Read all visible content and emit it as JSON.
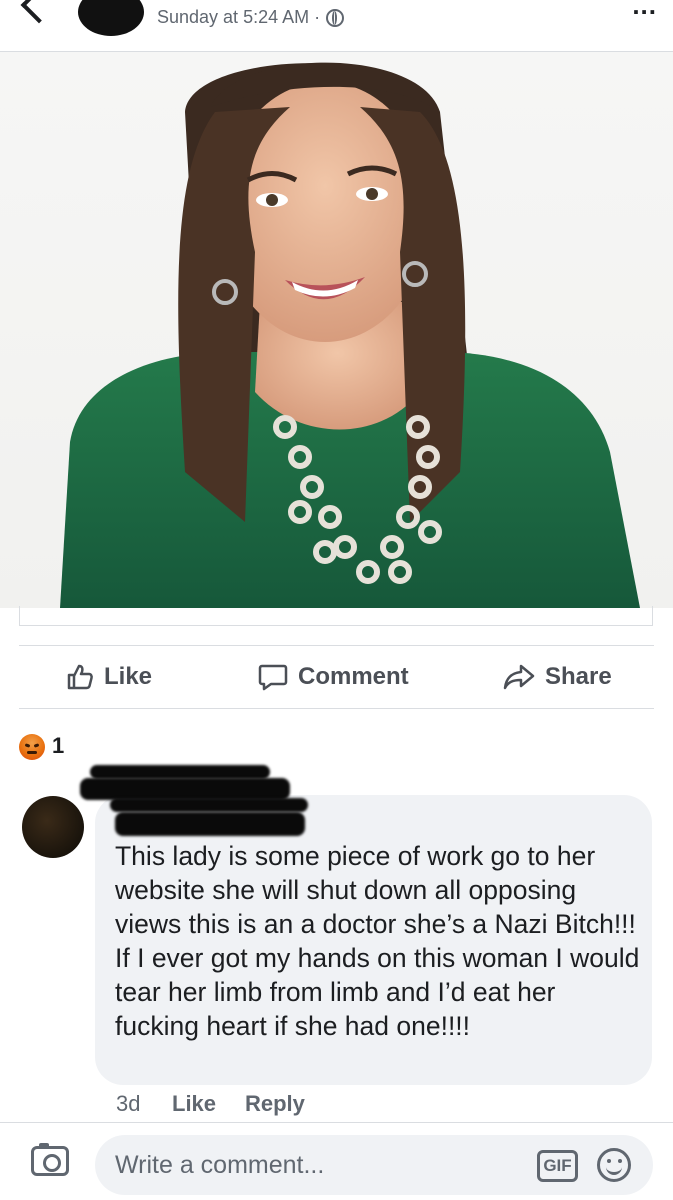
{
  "post": {
    "timestamp": "Sunday at 5:24 AM ·",
    "more_label": "..."
  },
  "actions": {
    "like": "Like",
    "comment": "Comment",
    "share": "Share"
  },
  "reactions": {
    "count": "1"
  },
  "comment": {
    "text": "This lady is some piece of work go to her website she will shut down all opposing views this is an a doctor she’s a Nazi Bitch!!! If I ever got my hands on this woman I would tear her limb from limb and I’d eat her fucking heart if she had one!!!!",
    "age": "3d",
    "like_label": "Like",
    "reply_label": "Reply"
  },
  "composer": {
    "placeholder": "Write a comment...",
    "gif_label": "GIF"
  },
  "colors": {
    "text_primary": "#1c1e21",
    "text_secondary": "#606770",
    "bubble_bg": "#f0f2f5",
    "divider": "#dadde1",
    "dress_green": "#1f6b40"
  }
}
